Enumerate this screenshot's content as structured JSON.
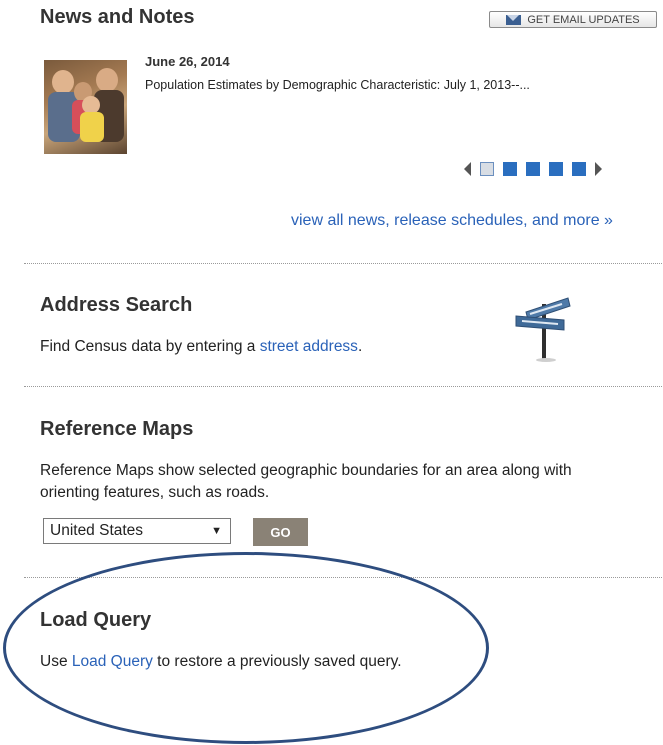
{
  "news": {
    "title": "News and Notes",
    "email_button_label": "GET EMAIL UPDATES",
    "date": "June 26, 2014",
    "description": "Population Estimates by Demographic Characteristic: July 1, 2013--...",
    "view_all_link": "view all news, release schedules, and more »"
  },
  "address_search": {
    "title": "Address Search",
    "text_before": "Find Census data by entering a ",
    "link": "street address",
    "text_after": "."
  },
  "reference_maps": {
    "title": "Reference Maps",
    "line1": "Reference Maps show selected geographic boundaries for an area along with",
    "line2": "orienting features, such as roads.",
    "select_value": "United States",
    "go_label": "GO"
  },
  "load_query": {
    "title": "Load Query",
    "text_before": "Use ",
    "link": "Load Query",
    "text_after": " to restore a previously saved query."
  },
  "colors": {
    "link": "#2a62b8",
    "pager_dot": "#2a6ebf",
    "go_button": "#8a8276",
    "highlight_ellipse": "#2e4d7f"
  }
}
